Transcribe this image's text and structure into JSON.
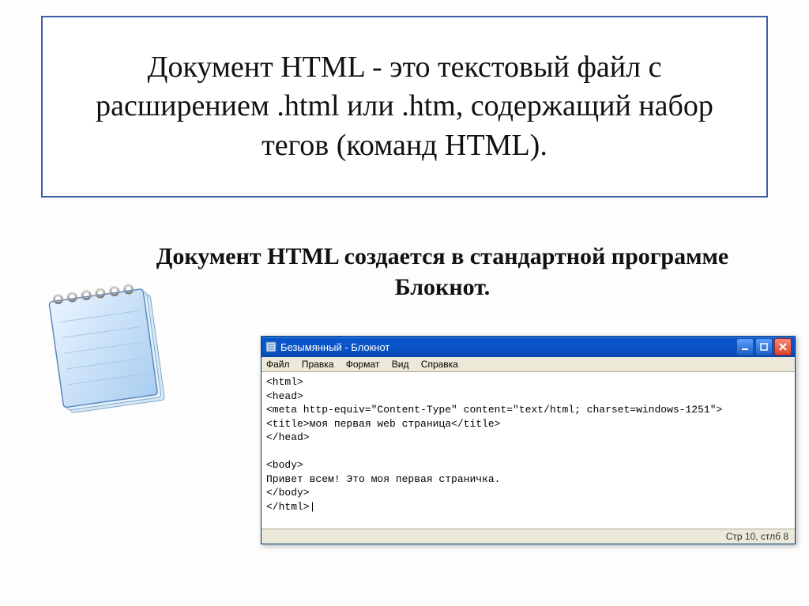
{
  "top_text": "Документ HTML - это текстовый файл с расширением .html или .htm, содержащий набор тегов (команд HTML).",
  "subtitle_before": "Документ HTML создается в стандартной программе ",
  "subtitle_bold": "Блокнот",
  "subtitle_after": ".",
  "window": {
    "title": "Безымянный - Блокнот",
    "menu": {
      "file": "Файл",
      "edit": "Правка",
      "format": "Формат",
      "view": "Вид",
      "help": "Справка"
    },
    "content": "<html>\n<head>\n<meta http-equiv=\"Content-Type\" content=\"text/html; charset=windows-1251\">\n<title>моя первая web страница</title>\n</head>\n\n<body>\nПривет всем! Это моя первая страничка.\n</body>\n</html>|",
    "status": "Стр 10, стлб 8"
  }
}
